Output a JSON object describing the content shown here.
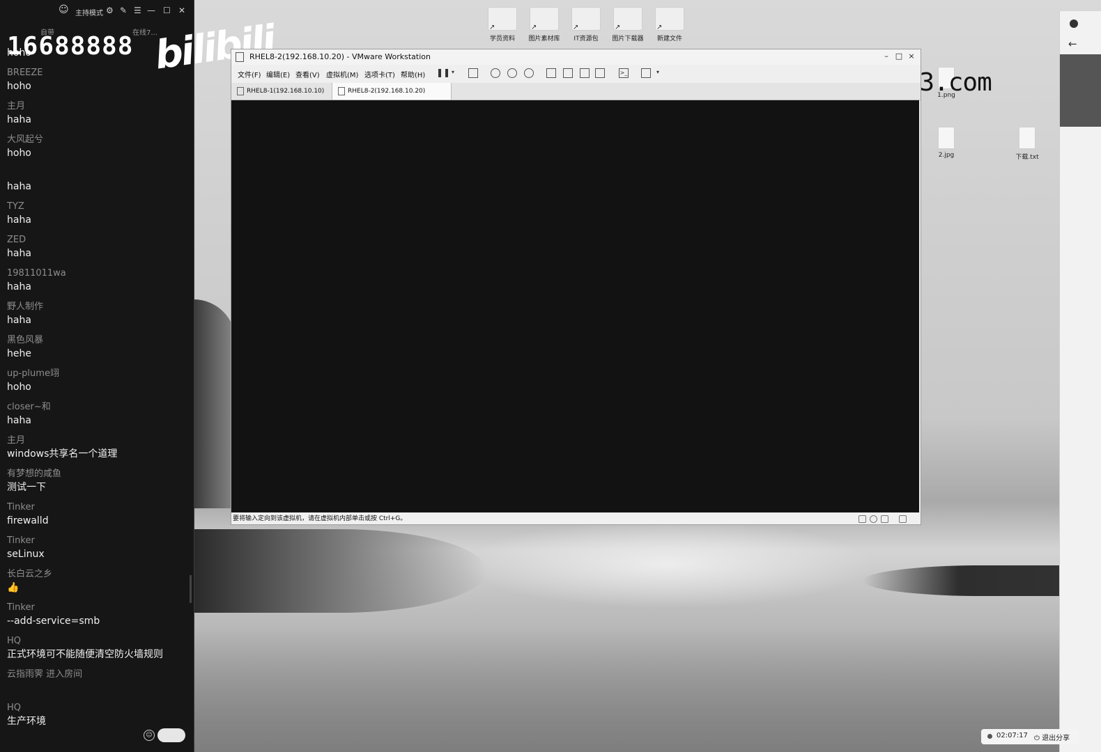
{
  "chat": {
    "top_mode_label": "主持模式",
    "sub_left": "自带",
    "sub_right": "在线7...",
    "overlay_number": "16688888",
    "logo_text": "bilibili",
    "messages": [
      {
        "user": "BREEZE",
        "text": "hoho"
      },
      {
        "user": "主月",
        "text": "haha"
      },
      {
        "user": "大风起兮",
        "text": "hoho"
      },
      {
        "user": "",
        "text": "haha"
      },
      {
        "user": "TYZ",
        "text": "haha"
      },
      {
        "user": "ZED",
        "text": "haha"
      },
      {
        "user": "19811011wa",
        "text": "haha"
      },
      {
        "user": "野人制作",
        "text": "haha"
      },
      {
        "user": "黑色风暴",
        "text": "hehe"
      },
      {
        "user": "up-plume翊",
        "text": "hoho"
      },
      {
        "user": "closer~和",
        "text": "haha"
      },
      {
        "user": "主月",
        "text": "windows共享名一个道理"
      },
      {
        "user": "有梦想的咸鱼",
        "text": "测试一下"
      },
      {
        "user": "Tinker",
        "text": "firewalld"
      },
      {
        "user": "Tinker",
        "text": "seLinux"
      },
      {
        "user": "长白云之乡",
        "text": "👍"
      },
      {
        "user": "Tinker",
        "text": "--add-service=smb"
      },
      {
        "user": "HQ",
        "text": "正式环境可不能随便清空防火墙规则"
      },
      {
        "user": "云指雨霁 进入房间",
        "text": ""
      },
      {
        "user": "HQ",
        "text": "生产环境"
      }
    ],
    "first_partial_text": "hoho"
  },
  "desktop": {
    "icons": [
      "学员资料",
      "图片素材库",
      "IT资源包",
      "图片下载器",
      "新建文件"
    ],
    "files": [
      {
        "label": "1.png"
      },
      {
        "label": "2.jpg"
      },
      {
        "label": "下载.txt"
      }
    ],
    "watermark": "www.heike123.com"
  },
  "vmware": {
    "title": "RHEL8-2(192.168.10.20) - VMware Workstation",
    "menu": [
      "文件(F)",
      "编辑(E)",
      "查看(V)",
      "虚拟机(M)",
      "选项卡(T)",
      "帮助(H)"
    ],
    "tabs": [
      {
        "label": "RHEL8-1(192.168.10.10)",
        "active": false
      },
      {
        "label": "RHEL8-2(192.168.10.20)",
        "active": true
      }
    ],
    "status_text": "要将输入定向到该虚拟机，请在虚拟机内部单击或按 Ctrl+G。"
  },
  "share": {
    "time": "02:07:17",
    "exit_label": "退出分享"
  }
}
